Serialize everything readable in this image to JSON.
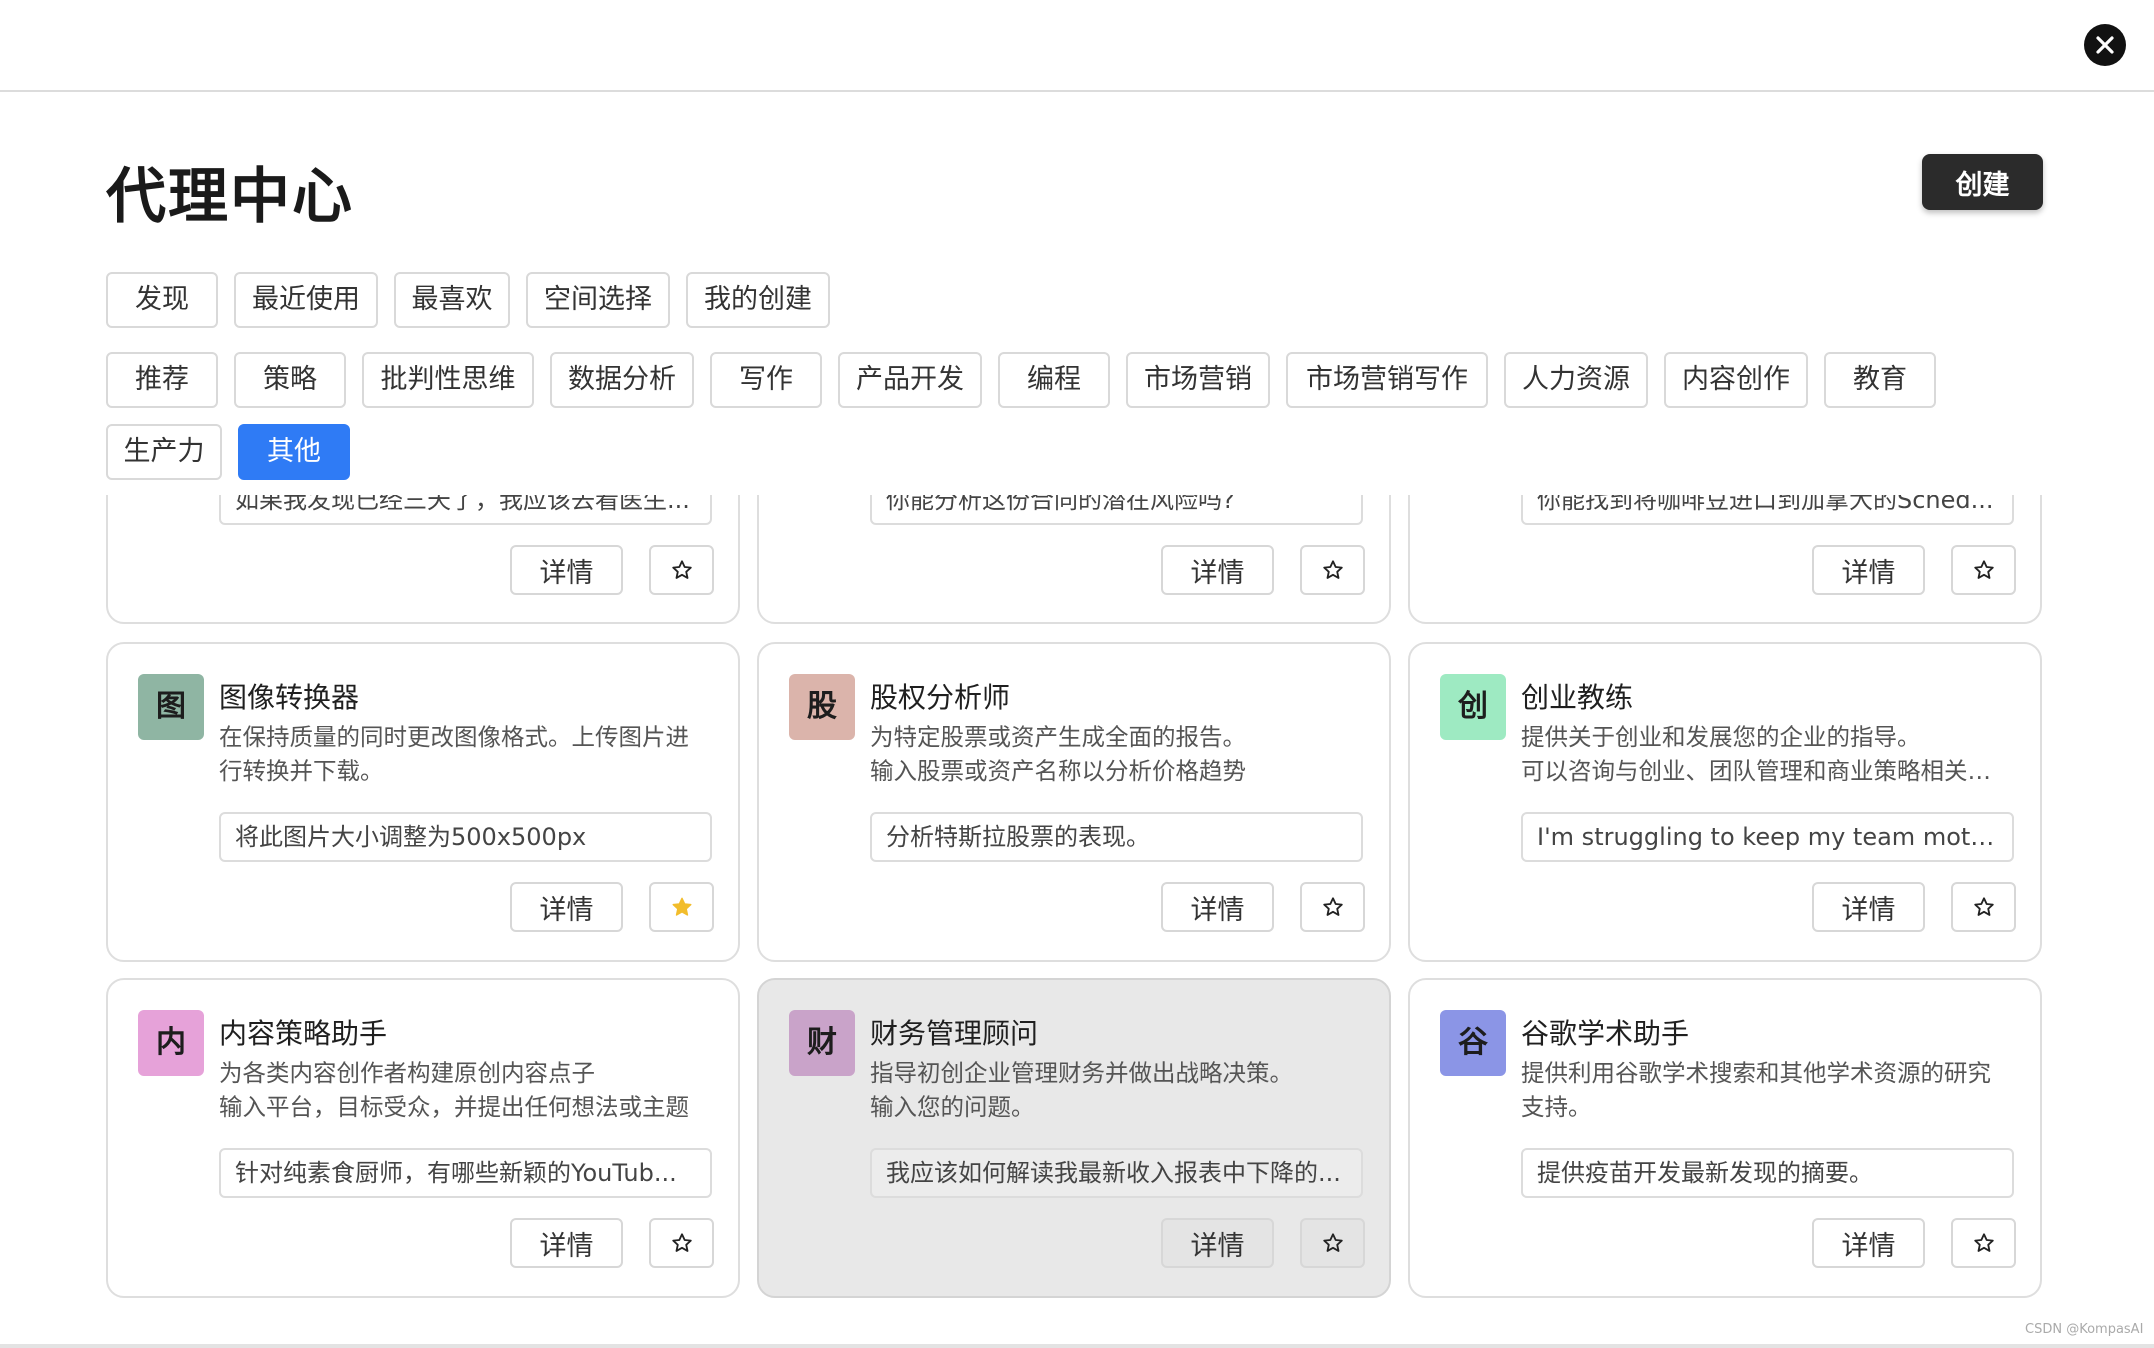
{
  "header": {
    "title": "代理中心",
    "create_label": "创建"
  },
  "tabs": [
    {
      "label": "发现",
      "active": true
    },
    {
      "label": "最近使用",
      "active": false
    },
    {
      "label": "最喜欢",
      "active": false
    },
    {
      "label": "空间选择",
      "active": false
    },
    {
      "label": "我的创建",
      "active": false
    }
  ],
  "categories": [
    {
      "label": "推荐",
      "active": false
    },
    {
      "label": "策略",
      "active": false
    },
    {
      "label": "批判性思维",
      "active": false
    },
    {
      "label": "数据分析",
      "active": false
    },
    {
      "label": "写作",
      "active": false
    },
    {
      "label": "产品开发",
      "active": false
    },
    {
      "label": "编程",
      "active": false
    },
    {
      "label": "市场营销",
      "active": false
    },
    {
      "label": "市场营销写作",
      "active": false
    },
    {
      "label": "人力资源",
      "active": false
    },
    {
      "label": "内容创作",
      "active": false
    },
    {
      "label": "教育",
      "active": false
    },
    {
      "label": "生产力",
      "active": false
    },
    {
      "label": "其他",
      "active": true
    }
  ],
  "partial_cards": [
    {
      "prompt": "如果我发现已经三天了，我应该去看医生..."
    },
    {
      "prompt": "你能分析这份合同的潜在风险吗?"
    },
    {
      "prompt": "你能找到将咖啡豆进口到加拿大的Sched..."
    }
  ],
  "cards": [
    {
      "avatar": "图",
      "avatar_color": "#8fb5a3",
      "title": "图像转换器",
      "desc": [
        "在保持质量的同时更改图像格式。上传图片进",
        "行转换并下载。"
      ],
      "prompt": "将此图片大小调整为500x500px",
      "favorited": true
    },
    {
      "avatar": "股",
      "avatar_color": "#dbb4ab",
      "title": "股权分析师",
      "desc": [
        "为特定股票或资产生成全面的报告。",
        "输入股票或资产名称以分析价格趋势"
      ],
      "prompt": "分析特斯拉股票的表现。",
      "favorited": false
    },
    {
      "avatar": "创",
      "avatar_color": "#9eeac2",
      "title": "创业教练",
      "desc": [
        "提供关于创业和发展您的企业的指导。",
        "可以咨询与创业、团队管理和商业策略相关…"
      ],
      "prompt": "I'm struggling to keep my team motiva...",
      "favorited": false
    },
    {
      "avatar": "内",
      "avatar_color": "#e6a2d9",
      "title": "内容策略助手",
      "desc": [
        "为各类内容创作者构建原创内容点子",
        "输入平台，目标受众，并提出任何想法或主题"
      ],
      "prompt": "针对纯素食厨师，有哪些新颖的YouTub...",
      "favorited": false
    },
    {
      "avatar": "财",
      "avatar_color": "#c9a3c9",
      "title": "财务管理顾问",
      "desc": [
        "指导初创企业管理财务并做出战略决策。",
        "输入您的问题。"
      ],
      "prompt": "我应该如何解读我最新收入报表中下降的...",
      "favorited": false
    },
    {
      "avatar": "谷",
      "avatar_color": "#8b95e6",
      "title": "谷歌学术助手",
      "desc": [
        "提供利用谷歌学术搜索和其他学术资源的研究",
        "支持。"
      ],
      "prompt": "提供疫苗开发最新发现的摘要。",
      "favorited": false
    }
  ],
  "detail_label": "详情",
  "star_color": "#f2bd2c",
  "watermark": "CSDN @KompasAI"
}
